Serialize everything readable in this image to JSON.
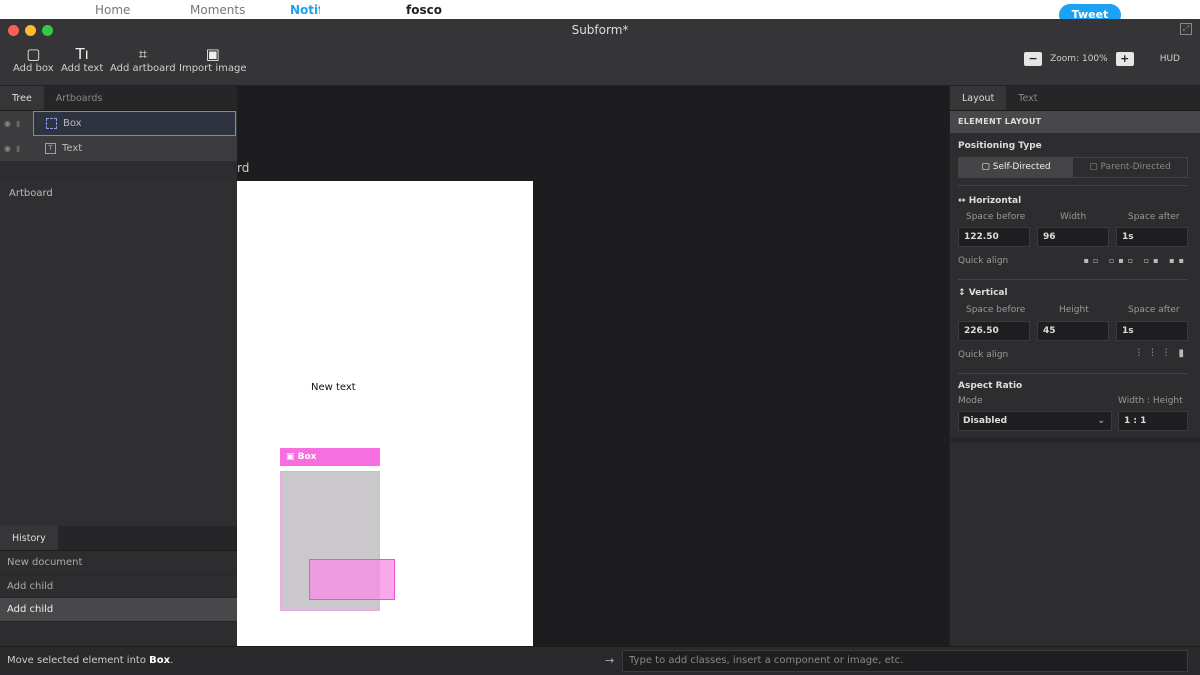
{
  "background": {
    "items": [
      "Home",
      "Moments",
      "Notif",
      "fosco"
    ],
    "tweet_label": "Tweet",
    "close_glyph": "✕"
  },
  "window": {
    "title": "Subform*"
  },
  "toolbar": {
    "tools": [
      {
        "label": "Add box",
        "icon": "box-icon"
      },
      {
        "label": "Add text",
        "icon": "text-icon"
      },
      {
        "label": "Add artboard",
        "icon": "artboard-icon"
      },
      {
        "label": "Import image",
        "icon": "image-icon"
      }
    ],
    "zoom_minus": "−",
    "zoom_label": "Zoom: 100%",
    "zoom_plus": "+",
    "hud_label": "HUD"
  },
  "left_panel": {
    "tabs": [
      "Tree",
      "Artboards"
    ],
    "active_tab": "Tree",
    "tree": {
      "root": "Artboard",
      "children": [
        "Box",
        "Text"
      ]
    },
    "history": {
      "tab": "History",
      "items": [
        "New document",
        "Add child",
        "Add child"
      ],
      "current_index": 2
    }
  },
  "canvas": {
    "artboard_label_fragment": "rd",
    "text_content": "New text",
    "box_label": "Box"
  },
  "right_panel": {
    "tabs": [
      "Layout",
      "Text"
    ],
    "active_tab": "Layout",
    "section_title": "ELEMENT LAYOUT",
    "positioning": {
      "label": "Positioning Type",
      "options": [
        "Self-Directed",
        "Parent-Directed"
      ],
      "selected": "Self-Directed"
    },
    "horizontal": {
      "label": "Horizontal",
      "col_labels": [
        "Space before",
        "Width",
        "Space after"
      ],
      "values": [
        "122.50",
        "96",
        "1s"
      ],
      "quick_align": "Quick align"
    },
    "vertical": {
      "label": "Vertical",
      "col_labels": [
        "Space before",
        "Height",
        "Space after"
      ],
      "values": [
        "226.50",
        "45",
        "1s"
      ],
      "quick_align": "Quick align"
    },
    "aspect": {
      "label": "Aspect Ratio",
      "mode_label": "Mode",
      "ratio_label": "Width : Height",
      "mode_value": "Disabled",
      "ratio_value": "1 : 1"
    }
  },
  "status": {
    "message_prefix": "Move selected element into ",
    "message_target": "Box",
    "message_suffix": ".",
    "command_placeholder": "Type to add classes, insert a component or image, etc."
  },
  "colors": {
    "accent_pink": "#f76ee0",
    "selection_blue": "#5d8fe8",
    "traffic_close": "#fc5f57",
    "traffic_min": "#fdbc2e",
    "traffic_max": "#34c84a"
  }
}
